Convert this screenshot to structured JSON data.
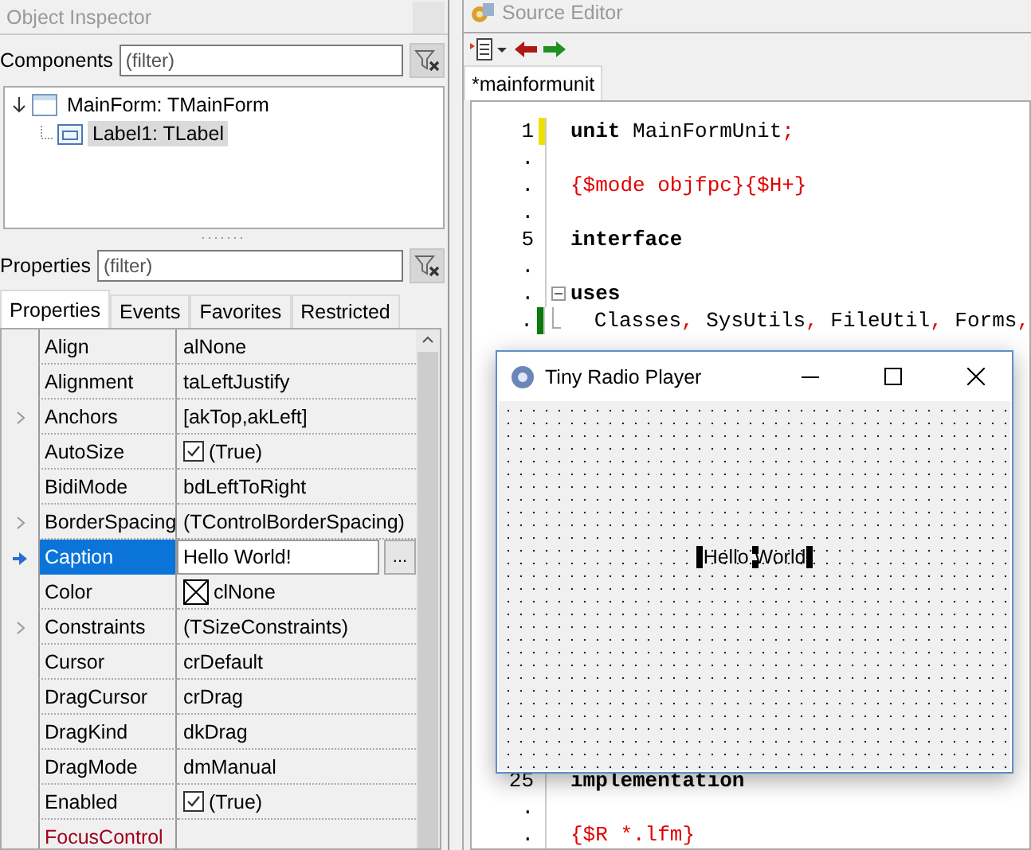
{
  "inspector": {
    "title": "Object Inspector",
    "components": {
      "label": "Components",
      "placeholder": "(filter)"
    },
    "tree": [
      {
        "label": "MainForm: TMainForm",
        "expanded": true,
        "selected": false,
        "children": [
          {
            "label": "Label1: TLabel",
            "selected": true
          }
        ]
      }
    ],
    "properties_filter": {
      "label": "Properties",
      "placeholder": "(filter)"
    },
    "tabs": [
      {
        "label": "Properties",
        "selected": true
      },
      {
        "label": "Events",
        "selected": false
      },
      {
        "label": "Favorites",
        "selected": false
      },
      {
        "label": "Restricted",
        "selected": false
      }
    ],
    "rows": [
      {
        "name": "Align",
        "value": "alNone",
        "kind": "text",
        "expandable": false,
        "selected": false,
        "reference": false
      },
      {
        "name": "Alignment",
        "value": "taLeftJustify",
        "kind": "text",
        "expandable": false,
        "selected": false,
        "reference": false
      },
      {
        "name": "Anchors",
        "value": "[akTop,akLeft]",
        "kind": "text",
        "expandable": true,
        "selected": false,
        "reference": false
      },
      {
        "name": "AutoSize",
        "value": "(True)",
        "kind": "check",
        "checked": true,
        "expandable": false,
        "selected": false,
        "reference": false
      },
      {
        "name": "BidiMode",
        "value": "bdLeftToRight",
        "kind": "text",
        "expandable": false,
        "selected": false,
        "reference": false
      },
      {
        "name": "BorderSpacing",
        "value": "(TControlBorderSpacing)",
        "kind": "text",
        "expandable": true,
        "selected": false,
        "reference": false
      },
      {
        "name": "Caption",
        "value": "Hello World!",
        "kind": "edit",
        "button": "...",
        "expandable": false,
        "selected": true,
        "reference": false
      },
      {
        "name": "Color",
        "value": "clNone",
        "kind": "color",
        "expandable": false,
        "selected": false,
        "reference": false
      },
      {
        "name": "Constraints",
        "value": "(TSizeConstraints)",
        "kind": "text",
        "expandable": true,
        "selected": false,
        "reference": false
      },
      {
        "name": "Cursor",
        "value": "crDefault",
        "kind": "text",
        "expandable": false,
        "selected": false,
        "reference": false
      },
      {
        "name": "DragCursor",
        "value": "crDrag",
        "kind": "text",
        "expandable": false,
        "selected": false,
        "reference": false
      },
      {
        "name": "DragKind",
        "value": "dkDrag",
        "kind": "text",
        "expandable": false,
        "selected": false,
        "reference": false
      },
      {
        "name": "DragMode",
        "value": "dmManual",
        "kind": "text",
        "expandable": false,
        "selected": false,
        "reference": false
      },
      {
        "name": "Enabled",
        "value": "(True)",
        "kind": "check",
        "checked": true,
        "expandable": false,
        "selected": false,
        "reference": false
      },
      {
        "name": "FocusControl",
        "kind": "text",
        "expandable": false,
        "selected": false,
        "reference": true
      }
    ]
  },
  "editor": {
    "title": "Source Editor",
    "tabs": [
      {
        "label": "*mainformunit",
        "selected": true
      }
    ],
    "lines_top": [
      {
        "number": "1",
        "unsaved": true,
        "saved": false,
        "fold_start": false,
        "fold_line": false,
        "tokens": [
          {
            "text": "unit",
            "kind": "keyword"
          },
          {
            "text": " MainFormUnit",
            "kind": "ident"
          },
          {
            "text": ";",
            "kind": "symbol"
          }
        ]
      },
      {
        "number": ".",
        "unsaved": false,
        "saved": false,
        "fold_start": false,
        "fold_line": false
      },
      {
        "number": ".",
        "unsaved": false,
        "saved": false,
        "fold_start": false,
        "fold_line": false,
        "tokens": [
          {
            "text": "{$mode objfpc}{$H+}",
            "kind": "directive"
          }
        ]
      },
      {
        "number": ".",
        "unsaved": false,
        "saved": false,
        "fold_start": false,
        "fold_line": false
      },
      {
        "number": "5",
        "unsaved": false,
        "saved": false,
        "fold_start": false,
        "fold_line": false,
        "tokens": [
          {
            "text": "interface",
            "kind": "keyword"
          }
        ]
      },
      {
        "number": ".",
        "unsaved": false,
        "saved": false,
        "fold_start": false,
        "fold_line": false
      },
      {
        "number": ".",
        "unsaved": false,
        "saved": false,
        "fold_start": true,
        "fold_line": false,
        "tokens": [
          {
            "text": "uses",
            "kind": "keyword"
          }
        ]
      },
      {
        "number": ".",
        "unsaved": false,
        "saved": true,
        "fold_start": false,
        "fold_line": true,
        "tokens": [
          {
            "text": "  Classes",
            "kind": "ident"
          },
          {
            "text": ",",
            "kind": "symbol"
          },
          {
            "text": " SysUtils",
            "kind": "ident"
          },
          {
            "text": ",",
            "kind": "symbol"
          },
          {
            "text": " FileUtil",
            "kind": "ident"
          },
          {
            "text": ",",
            "kind": "symbol"
          },
          {
            "text": " Forms",
            "kind": "ident"
          },
          {
            "text": ",",
            "kind": "symbol"
          }
        ]
      }
    ],
    "lines_bottom": [
      {
        "number": "25",
        "unsaved": false,
        "saved": false,
        "fold_start": false,
        "fold_line": false,
        "tokens": [
          {
            "text": "implementation",
            "kind": "keyword"
          }
        ]
      },
      {
        "number": ".",
        "unsaved": false,
        "saved": false,
        "fold_start": false,
        "fold_line": false
      },
      {
        "number": ".",
        "unsaved": false,
        "saved": false,
        "fold_start": false,
        "fold_line": false,
        "tokens": [
          {
            "text": "{$R *.lfm}",
            "kind": "directive"
          }
        ]
      }
    ]
  },
  "form_window": {
    "title": "Tiny Radio Player",
    "label": {
      "text": "Hello World",
      "selected": true
    }
  }
}
